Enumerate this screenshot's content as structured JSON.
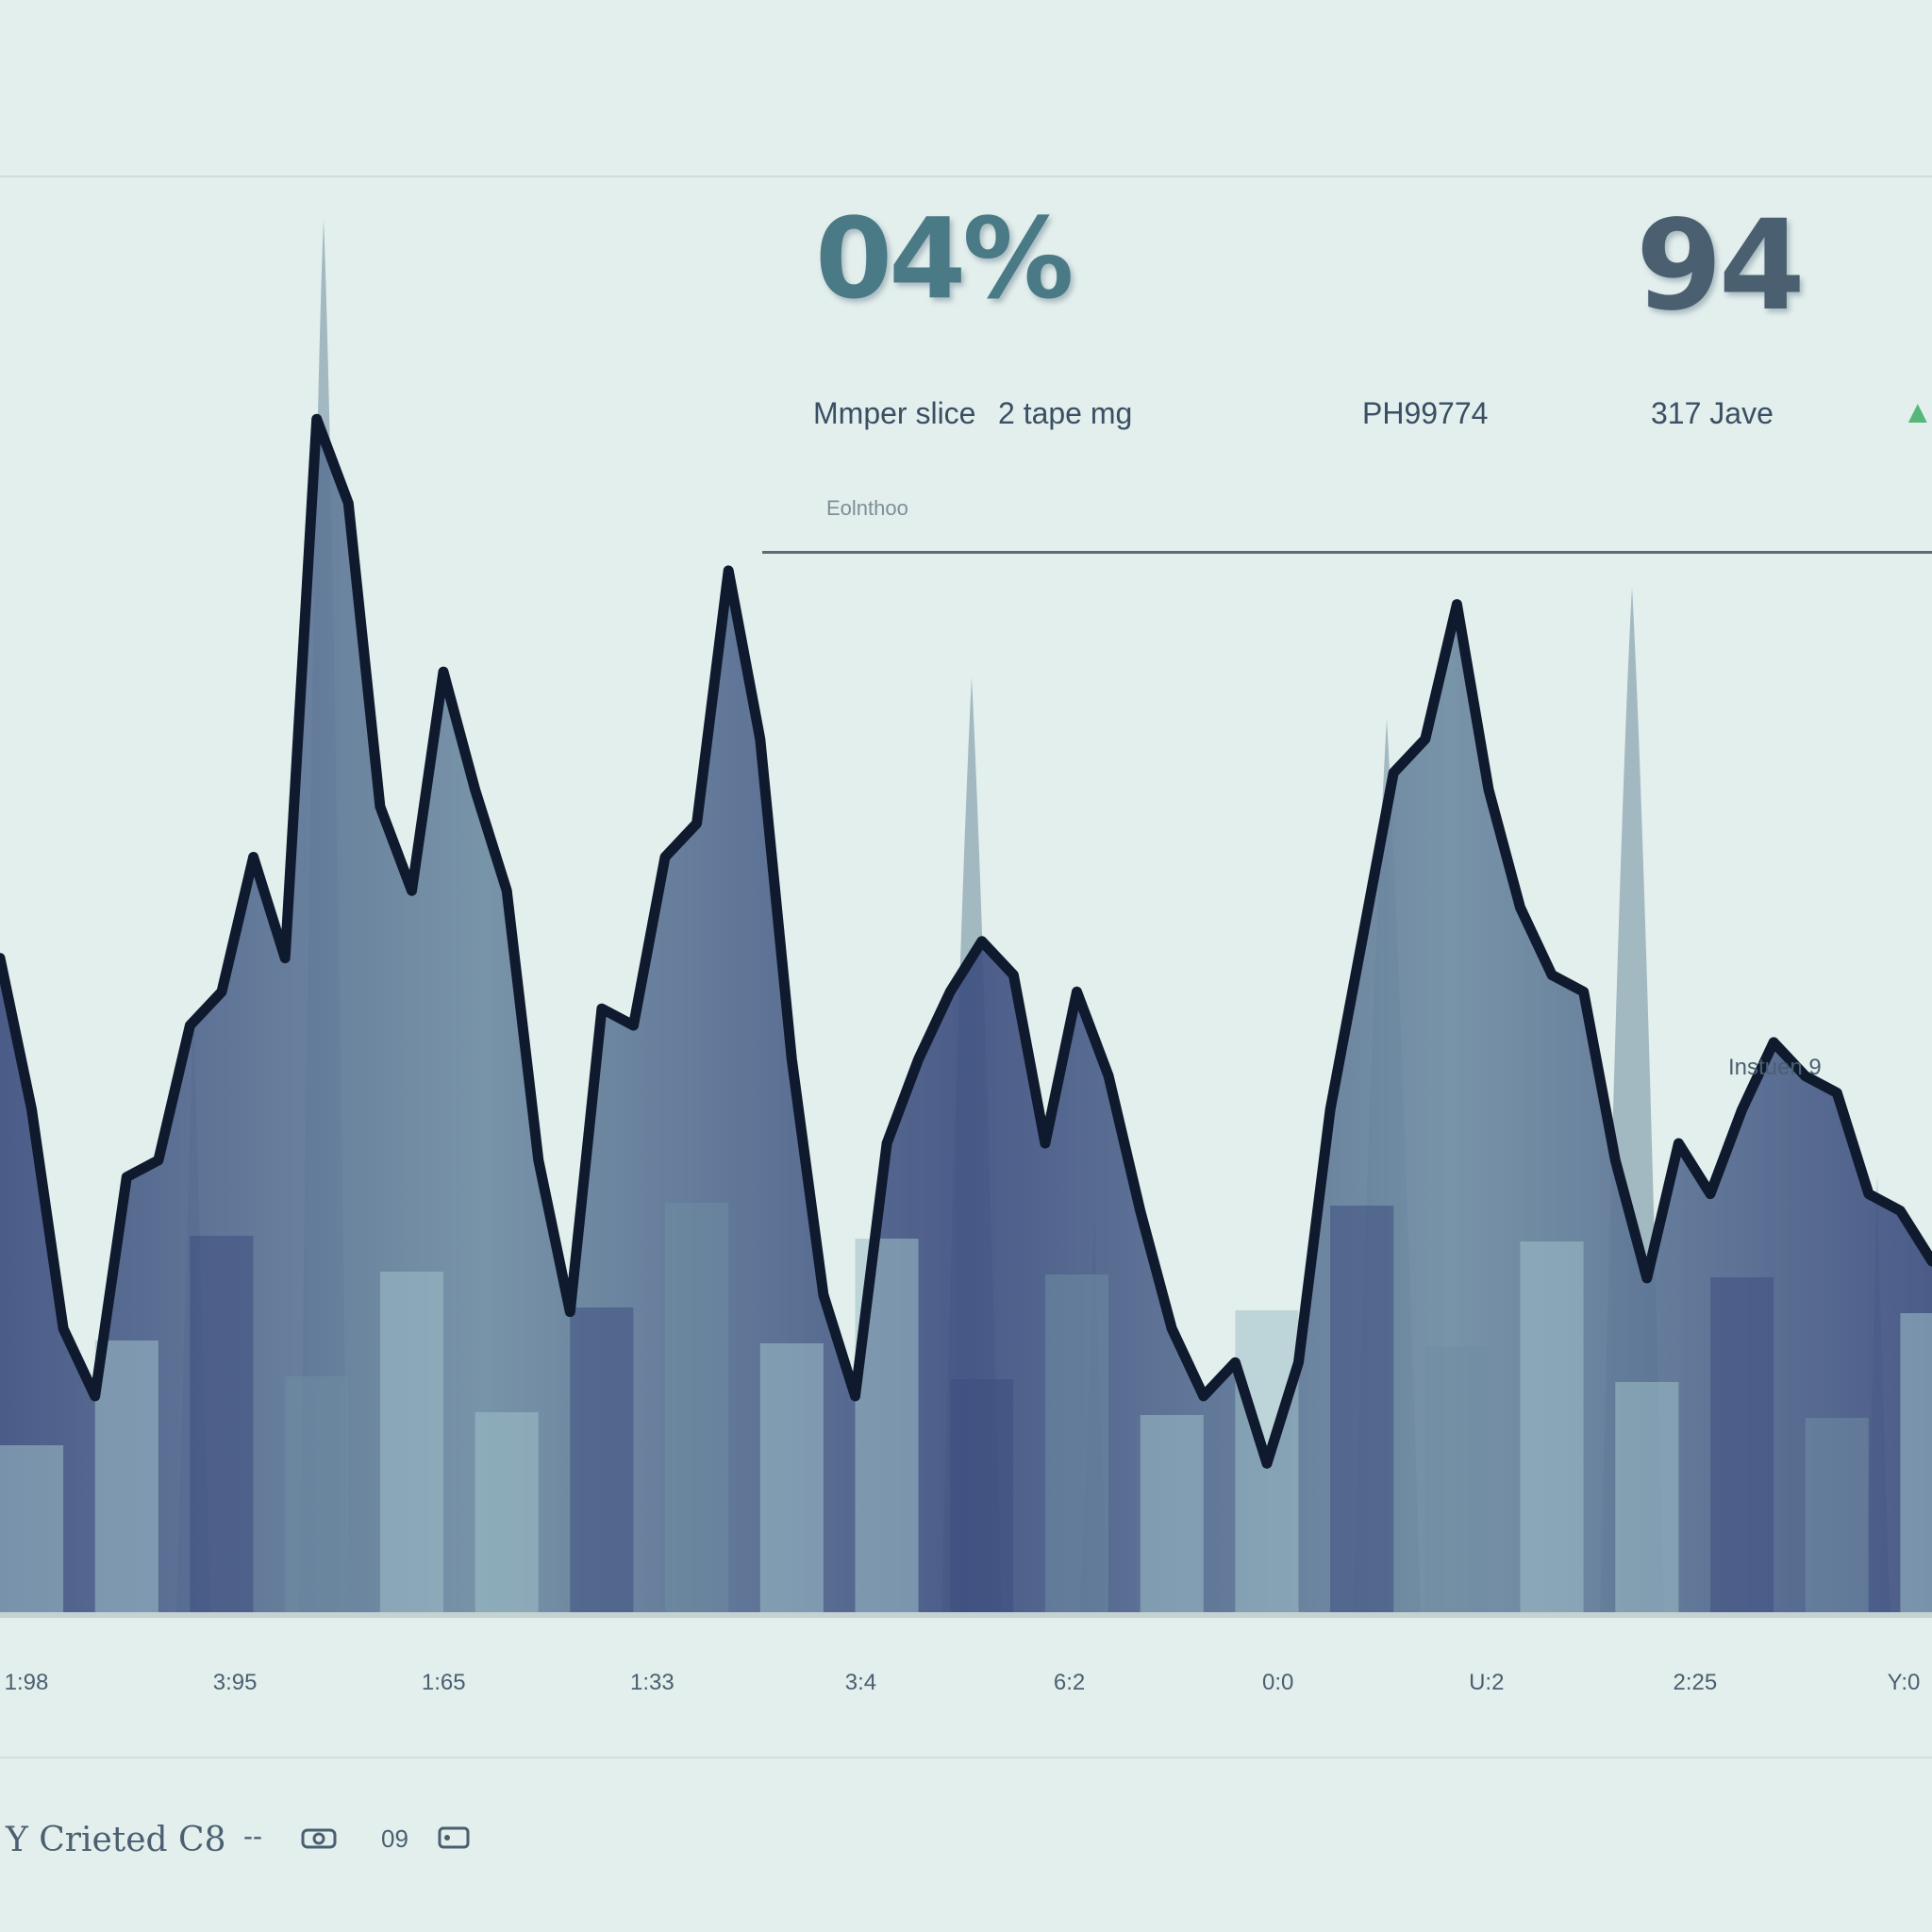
{
  "kpis": [
    {
      "value": "04%"
    },
    {
      "value": "94"
    }
  ],
  "kpi_delta": "▲",
  "sublabels": [
    "Mmper slice",
    "2 tape mg",
    "PH99774",
    "317 Jave"
  ],
  "panel_footnote": "Eolnthoo",
  "annotation": "Instuen 9",
  "footer": {
    "text": "Y Crieted C8",
    "dash": "--",
    "number": "09"
  },
  "colors": {
    "background": "#e3efed",
    "line": "#101a2e",
    "fill_dark": "#3e4f80",
    "fill_mid": "#6f8ca2",
    "fill_light": "#9fc0c8",
    "spire": "#6d8c9c",
    "accent_green": "#55b87a"
  },
  "chart_data": {
    "type": "area",
    "x_tick_labels": [
      "1:98",
      "3:95",
      "1:65",
      "1:33",
      "3:4",
      "6:2",
      "0:0",
      "U:2",
      "2:25",
      "Y:0"
    ],
    "series": [
      {
        "values": [
          3.9,
          3.0,
          1.7,
          1.3,
          2.6,
          2.7,
          3.5,
          3.7,
          4.5,
          3.9,
          7.1,
          6.6,
          4.8,
          4.3,
          5.6,
          4.9,
          4.3,
          2.7,
          1.8,
          3.6,
          3.5,
          4.5,
          4.7,
          6.2,
          5.2,
          3.3,
          1.9,
          1.3,
          2.8,
          3.3,
          3.7,
          4.0,
          3.8,
          2.8,
          3.7,
          3.2,
          2.4,
          1.7,
          1.3,
          1.5,
          0.9,
          1.5,
          3.0,
          4.0,
          5.0,
          5.2,
          6.0,
          4.9,
          4.2,
          3.8,
          3.7,
          2.7,
          2.0,
          2.8,
          2.5,
          3.0,
          3.4,
          3.2,
          3.1,
          2.5,
          2.4,
          2.1
        ]
      }
    ],
    "ylim": [
      0,
      10
    ],
    "grid": false,
    "legend": "none"
  }
}
